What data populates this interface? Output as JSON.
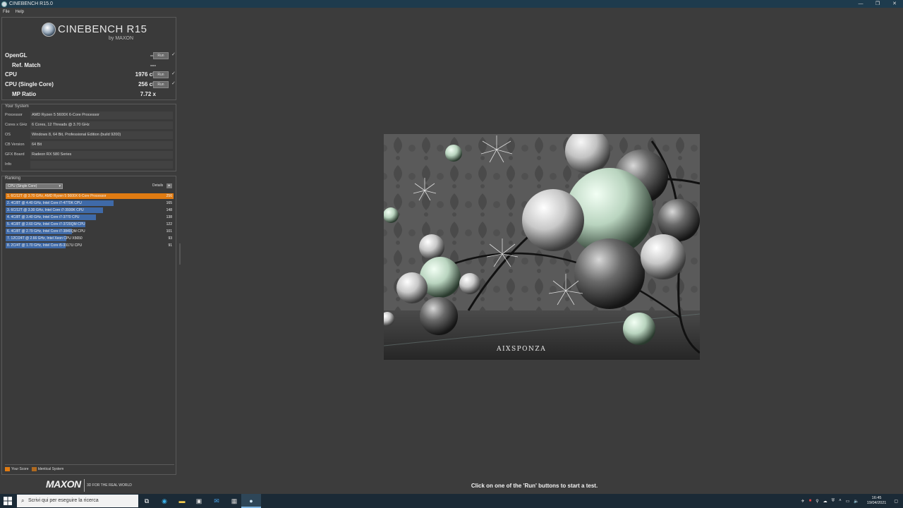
{
  "window": {
    "title": "CINEBENCH R15.0",
    "buttons": [
      "—",
      "❐",
      "✕"
    ]
  },
  "menu": [
    "File",
    "Help"
  ],
  "logo": {
    "name": "CINEBENCH R15",
    "by": "by MAXON"
  },
  "tests": [
    {
      "label": "OpenGL",
      "value": "---",
      "run": "Run",
      "check": "✓",
      "indent": false
    },
    {
      "label": "Ref. Match",
      "value": "---",
      "run": "",
      "check": "",
      "indent": true
    },
    {
      "label": "CPU",
      "value": "1976 cb",
      "run": "Run",
      "check": "✓",
      "indent": false
    },
    {
      "label": "CPU (Single Core)",
      "value": "256 cb",
      "run": "Run",
      "check": "✓",
      "indent": false
    },
    {
      "label": "MP Ratio",
      "value": "7.72 x",
      "run": "",
      "check": "",
      "indent": true
    }
  ],
  "system": {
    "title": "Your System",
    "rows": [
      {
        "key": "Processor",
        "value": "AMD Ryzen 5 5600X 6-Core Processor"
      },
      {
        "key": "Cores x GHz",
        "value": "6 Cores, 12 Threads @ 3.70 GHz"
      },
      {
        "key": "OS",
        "value": "Windows 8, 64 Bit, Professional Edition (build 9200)"
      },
      {
        "key": "CB Version",
        "value": "64 Bit"
      },
      {
        "key": "GFX Board",
        "value": "Radeon RX 580 Series"
      },
      {
        "key": "Info",
        "value": ""
      }
    ]
  },
  "ranking": {
    "title": "Ranking",
    "selected": "CPU (Single Core)",
    "details_label": "Details",
    "max_score": 256,
    "entries": [
      {
        "label": "1. 6C/12T @ 3.70 GHz, AMD Ryzen 5 5600X 6-Core Processor",
        "score": 256,
        "you": true
      },
      {
        "label": "2. 4C/8T @ 4.40 GHz, Intel Core i7-4770K CPU",
        "score": 165,
        "you": false
      },
      {
        "label": "3. 6C/12T @ 3.30 GHz,  Intel Core i7-3930K CPU",
        "score": 148,
        "you": false
      },
      {
        "label": "4. 4C/8T @ 3.40 GHz,  Intel Core i7-3770 CPU",
        "score": 138,
        "you": false
      },
      {
        "label": "5. 4C/8T @ 2.60 GHz, Intel Core i7-3720QM CPU",
        "score": 122,
        "you": false
      },
      {
        "label": "6. 4C/8T @ 2.79 GHz,  Intel Core i7-3840QM CPU",
        "score": 101,
        "you": false
      },
      {
        "label": "7. 12C/24T @ 2.66 GHz, Intel Xeon CPU X5650",
        "score": 93,
        "you": false
      },
      {
        "label": "8. 2C/4T @ 1.70 GHz,  Intel Core i5-3317U CPU",
        "score": 91,
        "you": false
      }
    ],
    "legend": {
      "your_score": "Your Score",
      "identical": "Identical System",
      "your_color": "#e07b12",
      "identical_color": "#b06a20"
    }
  },
  "brand": {
    "name": "MAXON",
    "tagline": "3D FOR THE REAL WORLD"
  },
  "render": {
    "watermark": "AIXSPONZA"
  },
  "status": "Click on one of the 'Run' buttons to start a test.",
  "taskbar": {
    "search_placeholder": "Scrivi qui per eseguire la ricerca",
    "time": "16:45",
    "date": "19/04/2021"
  }
}
